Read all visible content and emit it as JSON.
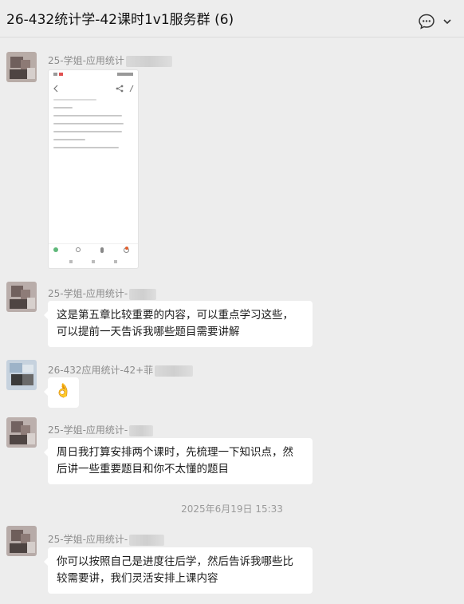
{
  "header": {
    "title": "26-432统计学-42课时1v1服务群 (6)",
    "more_icon": "chat-bubble-ellipsis-icon",
    "chevron_icon": "chevron-down-icon"
  },
  "messages": [
    {
      "sender": "25-学姐-应用统计",
      "type": "image"
    },
    {
      "sender": "25-学姐-应用统计-",
      "type": "text",
      "lines": [
        "这是第五章比较重要的内容，可以重点学习这些，",
        "可以提前一天告诉我哪些题目需要讲解"
      ]
    },
    {
      "sender": "26-432应用统计-42+菲",
      "type": "emoji",
      "emoji": "👌"
    },
    {
      "sender": "25-学姐-应用统计-",
      "type": "text",
      "lines": [
        "周日我打算安排两个课时，先梳理一下知识点，然",
        "后讲一些重要题目和你不太懂的题目"
      ]
    },
    {
      "sender": "25-学姐-应用统计-",
      "type": "text",
      "lines": [
        "你可以按照自己是进度往后学，然后告诉我哪些比",
        "较需要讲，我们灵活安排上课内容"
      ]
    }
  ],
  "timestamp": "2025年6月19日 15:33",
  "colors": {
    "background": "#ededed",
    "bubble": "#ffffff",
    "name": "#8c8c8c"
  }
}
